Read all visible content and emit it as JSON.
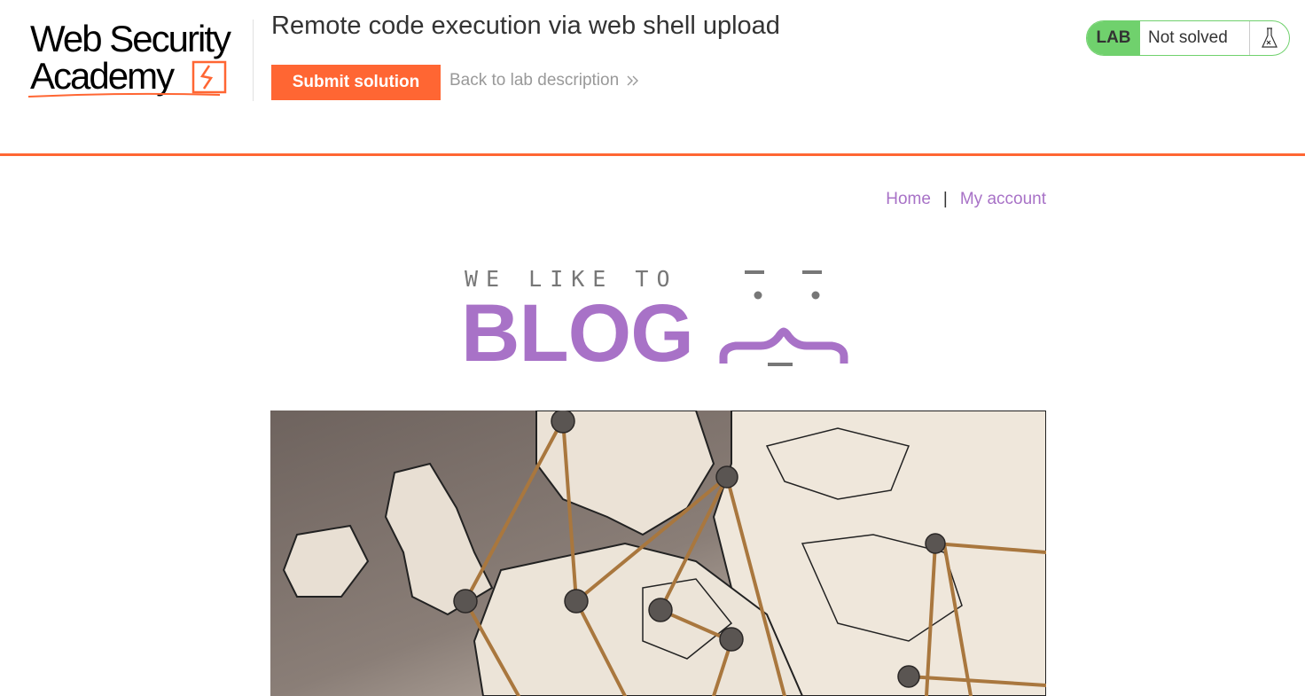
{
  "lab_header": {
    "logo": {
      "line1": "Web Security",
      "line2": "Academy"
    },
    "title": "Remote code execution via web shell upload",
    "submit_label": "Submit solution",
    "back_label": "Back to lab description",
    "status": {
      "lab_label": "LAB",
      "status_text": "Not solved",
      "icon": "flask-icon"
    }
  },
  "nav": {
    "home": "Home",
    "separator": "|",
    "account": "My account"
  },
  "banner": {
    "small_text": "WE LIKE TO",
    "big_text": "BLOG"
  },
  "hero": {
    "icon": "europe-map-with-pins-image"
  },
  "colors": {
    "accent": "#ff6633",
    "lab_green": "#70d16d",
    "blog_purple": "#a872c7"
  }
}
